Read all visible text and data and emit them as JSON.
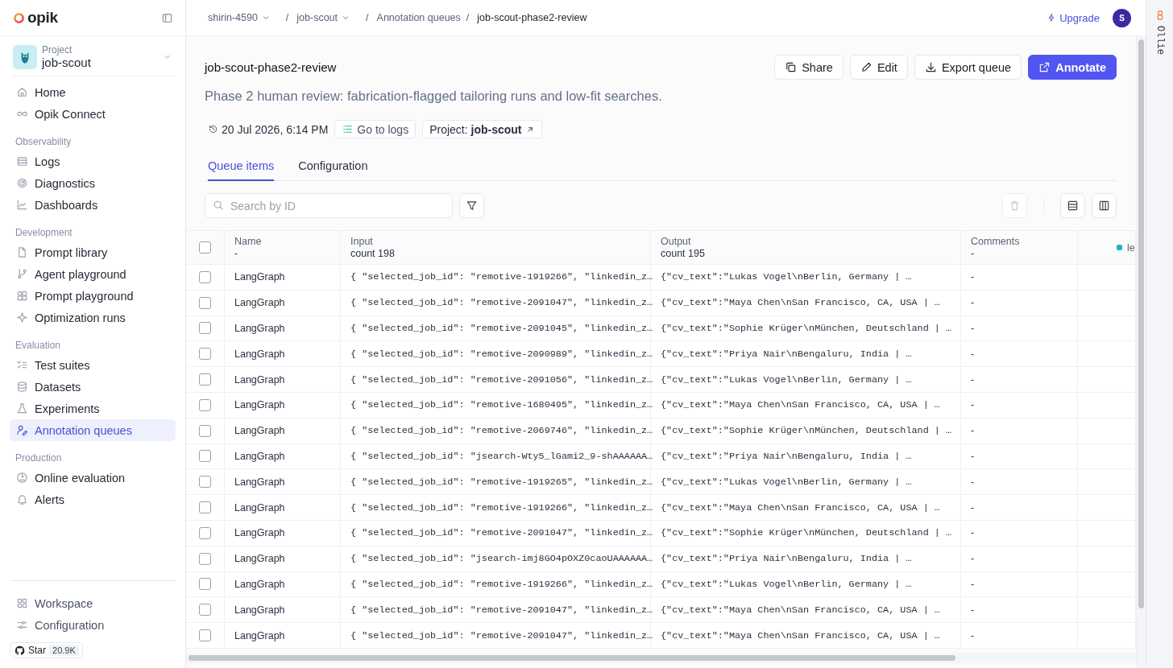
{
  "sidebar": {
    "logo": "opik",
    "project": {
      "label": "Project",
      "name": "job-scout"
    },
    "sections": [
      {
        "items": [
          {
            "label": "Home",
            "selected": false
          },
          {
            "label": "Opik Connect",
            "selected": false
          }
        ]
      },
      {
        "heading": "Observability",
        "items": [
          {
            "label": "Logs",
            "selected": false
          },
          {
            "label": "Diagnostics",
            "selected": false
          },
          {
            "label": "Dashboards",
            "selected": false
          }
        ]
      },
      {
        "heading": "Development",
        "items": [
          {
            "label": "Prompt library",
            "selected": false
          },
          {
            "label": "Agent playground",
            "selected": false
          },
          {
            "label": "Prompt playground",
            "selected": false
          },
          {
            "label": "Optimization runs",
            "selected": false
          }
        ]
      },
      {
        "heading": "Evaluation",
        "items": [
          {
            "label": "Test suites",
            "selected": false
          },
          {
            "label": "Datasets",
            "selected": false
          },
          {
            "label": "Experiments",
            "selected": false
          },
          {
            "label": "Annotation queues",
            "selected": true
          }
        ]
      },
      {
        "heading": "Production",
        "items": [
          {
            "label": "Online evaluation",
            "selected": false
          },
          {
            "label": "Alerts",
            "selected": false
          }
        ]
      }
    ],
    "footer_items": [
      {
        "label": "Workspace"
      },
      {
        "label": "Configuration"
      }
    ],
    "star": {
      "label": "Star",
      "count": "20.9K"
    }
  },
  "breadcrumbs": [
    {
      "kind": "dropdown",
      "text": "shirin-4590"
    },
    {
      "kind": "separator",
      "text": "/"
    },
    {
      "kind": "dropdown",
      "text": "job-scout"
    },
    {
      "kind": "separator",
      "text": "/"
    },
    {
      "kind": "link",
      "text": "Annotation queues"
    },
    {
      "kind": "separator",
      "text": "/"
    },
    {
      "kind": "current",
      "text": "job-scout-phase2-review"
    }
  ],
  "upgrade": "Upgrade",
  "avatar": "S",
  "title": "job-scout-phase2-review",
  "actions": [
    {
      "kind": "outline",
      "label": "Share"
    },
    {
      "kind": "outline",
      "label": "Edit"
    },
    {
      "kind": "outline",
      "label": "Export queue"
    },
    {
      "kind": "primary",
      "label": "Annotate"
    }
  ],
  "description": "Phase 2 human review: fabrication-flagged tailoring runs and low-fit searches.",
  "meta": {
    "date": "20 Jul 2026, 6:14 PM",
    "logs_link": "Go to logs",
    "project_link": "Project: **job-scout**"
  },
  "tabs": [
    {
      "label": "Queue items",
      "selected": true
    },
    {
      "label": "Configuration",
      "selected": false
    }
  ],
  "search": {
    "placeholder": "Search by ID"
  },
  "delete_disabled": true,
  "table": {
    "select_all": false,
    "columns": [
      {
        "label": "Name",
        "sub": "-"
      },
      {
        "label": "Input",
        "sub": "count 198"
      },
      {
        "label": "Output",
        "sub": "count 195"
      },
      {
        "label": "Comments",
        "sub": "-"
      },
      {
        "label": "le",
        "color": "#1bb5c4"
      }
    ],
    "rows": [
      {
        "checked": false,
        "name": "LangGraph",
        "input": "{ \"selected_job_id\": \"remotive-1919266\", \"linkedin_z…",
        "output": "{\"cv_text\":\"Lukas Vogel\\nBerlin, Germany | …",
        "comments": "-"
      },
      {
        "checked": false,
        "name": "LangGraph",
        "input": "{ \"selected_job_id\": \"remotive-2091047\", \"linkedin_z…",
        "output": "{\"cv_text\":\"Maya Chen\\nSan Francisco, CA, USA | …",
        "comments": "-"
      },
      {
        "checked": false,
        "name": "LangGraph",
        "input": "{ \"selected_job_id\": \"remotive-2091045\", \"linkedin_z…",
        "output": "{\"cv_text\":\"Sophie Krüger\\nMünchen, Deutschland | …",
        "comments": "-"
      },
      {
        "checked": false,
        "name": "LangGraph",
        "input": "{ \"selected_job_id\": \"remotive-2090989\", \"linkedin_z…",
        "output": "{\"cv_text\":\"Priya Nair\\nBengaluru, India | …",
        "comments": "-"
      },
      {
        "checked": false,
        "name": "LangGraph",
        "input": "{ \"selected_job_id\": \"remotive-2091056\", \"linkedin_z…",
        "output": "{\"cv_text\":\"Lukas Vogel\\nBerlin, Germany | …",
        "comments": "-"
      },
      {
        "checked": false,
        "name": "LangGraph",
        "input": "{ \"selected_job_id\": \"remotive-1680495\", \"linkedin_z…",
        "output": "{\"cv_text\":\"Maya Chen\\nSan Francisco, CA, USA | …",
        "comments": "-"
      },
      {
        "checked": false,
        "name": "LangGraph",
        "input": "{ \"selected_job_id\": \"remotive-2069746\", \"linkedin_z…",
        "output": "{\"cv_text\":\"Sophie Krüger\\nMünchen, Deutschland | …",
        "comments": "-"
      },
      {
        "checked": false,
        "name": "LangGraph",
        "input": "{ \"selected_job_id\": \"jsearch-Wty5_lGami2_9-shAAAAAA…",
        "output": "{\"cv_text\":\"Priya Nair\\nBengaluru, India | …",
        "comments": "-"
      },
      {
        "checked": false,
        "name": "LangGraph",
        "input": "{ \"selected_job_id\": \"remotive-1919265\", \"linkedin_z…",
        "output": "{\"cv_text\":\"Lukas Vogel\\nBerlin, Germany | …",
        "comments": "-"
      },
      {
        "checked": false,
        "name": "LangGraph",
        "input": "{ \"selected_job_id\": \"remotive-1919266\", \"linkedin_z…",
        "output": "{\"cv_text\":\"Maya Chen\\nSan Francisco, CA, USA | …",
        "comments": "-"
      },
      {
        "checked": false,
        "name": "LangGraph",
        "input": "{ \"selected_job_id\": \"remotive-2091047\", \"linkedin_z…",
        "output": "{\"cv_text\":\"Sophie Krüger\\nMünchen, Deutschland | …",
        "comments": "-"
      },
      {
        "checked": false,
        "name": "LangGraph",
        "input": "{ \"selected_job_id\": \"jsearch-imj8GO4pOXZ0caoUAAAAAA…",
        "output": "{\"cv_text\":\"Priya Nair\\nBengaluru, India | …",
        "comments": "-"
      },
      {
        "checked": false,
        "name": "LangGraph",
        "input": "{ \"selected_job_id\": \"remotive-1919266\", \"linkedin_z…",
        "output": "{\"cv_text\":\"Lukas Vogel\\nBerlin, Germany | …",
        "comments": "-"
      },
      {
        "checked": false,
        "name": "LangGraph",
        "input": "{ \"selected_job_id\": \"remotive-2091047\", \"linkedin_z…",
        "output": "{\"cv_text\":\"Maya Chen\\nSan Francisco, CA, USA | …",
        "comments": "-"
      },
      {
        "checked": false,
        "name": "LangGraph",
        "input": "{ \"selected_job_id\": \"remotive-2091047\", \"linkedin_z…",
        "output": "{\"cv_text\":\"Maya Chen\\nSan Francisco, CA, USA | …",
        "comments": "-"
      }
    ]
  },
  "assistant_panel": {
    "label": "Ollie"
  }
}
